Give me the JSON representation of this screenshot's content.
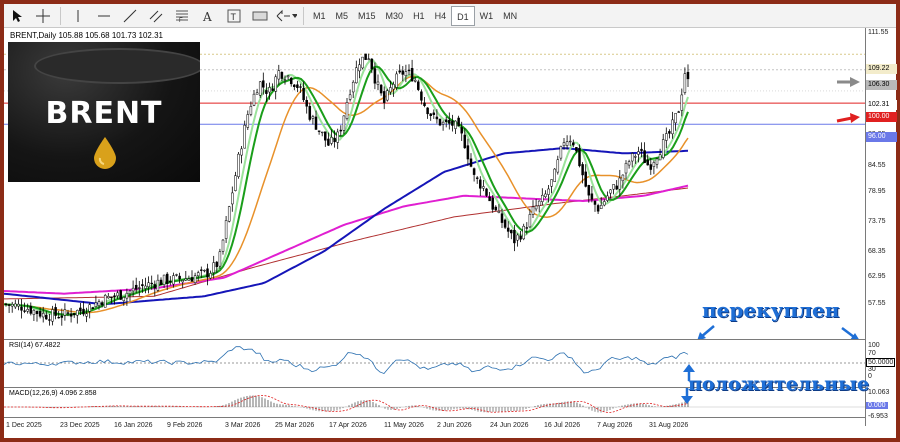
{
  "toolbar": {
    "timeframes": [
      "M1",
      "M5",
      "M15",
      "M30",
      "H1",
      "H4",
      "D1",
      "W1",
      "MN"
    ],
    "active_timeframe": "D1"
  },
  "chart": {
    "title": "BRENT,Daily  105.88 105.68 101.73 102.31",
    "image_text": "BRENT",
    "price_levels": [
      "111.55",
      "106.30",
      "102.31",
      "100.00",
      "96.00",
      "93.95",
      "89.95",
      "84.55",
      "78.95",
      "73.75",
      "68.35",
      "62.95",
      "57.55"
    ],
    "tags": {
      "upper": "109.22",
      "gray": "106.30",
      "current": "102.31",
      "red": "100.00",
      "blue": "96.00"
    },
    "colors": {
      "fast_ma": "#1a9e1a",
      "ma_light": "#9be39b",
      "orange_ma": "#e8912a",
      "blue_ma": "#1515b8",
      "magenta_ma": "#e01fd1",
      "brown_ma": "#b03030",
      "red_level": "#e02020",
      "blue_level": "#6a78e8"
    }
  },
  "rsi": {
    "title": "RSI(14) 67.4822",
    "levels": [
      "100",
      "70",
      "50.0000",
      "30",
      "0"
    ]
  },
  "macd": {
    "title": "MACD(12,26,9) 4.096 2.858",
    "levels": [
      "10.063",
      "0.000",
      "-6.953"
    ]
  },
  "xaxis": {
    "dates": [
      "1 Dec 2025",
      "23 Dec 2025",
      "16 Jan 2026",
      "9 Feb 2026",
      "3 Mar 2026",
      "25 Mar 2026",
      "17 Apr 2026",
      "11 May 2026",
      "2 Jun 2026",
      "24 Jun 2026",
      "16 Jul 2026",
      "7 Aug 2026",
      "31 Aug 2026"
    ]
  },
  "annotations": {
    "overbought": "перекуплен",
    "positive": "положительные"
  }
}
